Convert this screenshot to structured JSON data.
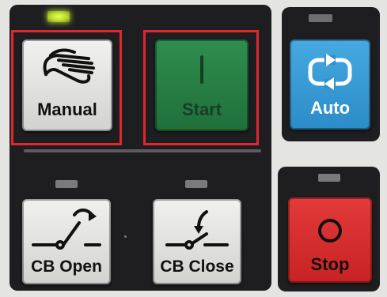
{
  "colors": {
    "panel": "#1e1e20",
    "background": "#e4e4e2",
    "highlight": "#e0262e",
    "indicator_on": "#cde83a",
    "indicator_off": "#7a7a7a"
  },
  "buttons": {
    "manual": {
      "label": "Manual",
      "icon": "hand-icon",
      "color": "grey"
    },
    "start": {
      "label": "Start",
      "icon": "start-line-icon",
      "color": "green"
    },
    "auto": {
      "label": "Auto",
      "icon": "cycle-arrows-icon",
      "color": "blue"
    },
    "cb_open": {
      "label": "CB Open",
      "icon": "breaker-open-icon",
      "color": "grey"
    },
    "cb_close": {
      "label": "CB Close",
      "icon": "breaker-close-icon",
      "color": "grey"
    },
    "stop": {
      "label": "Stop",
      "icon": "stop-circle-icon",
      "color": "red"
    }
  },
  "indicators": {
    "top": "on",
    "cb_open": "off",
    "cb_close": "off",
    "stop": "off"
  },
  "highlighted": [
    "Manual",
    "Start"
  ]
}
